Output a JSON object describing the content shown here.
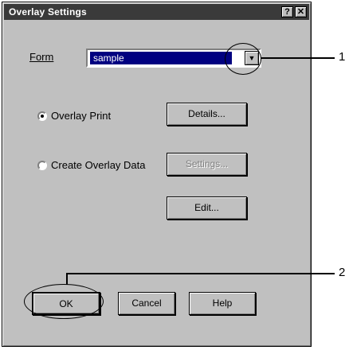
{
  "window": {
    "title": "Overlay Settings",
    "help_glyph": "?",
    "close_glyph": "✕"
  },
  "form": {
    "label": "Form",
    "selected_value": "sample",
    "dropdown_glyph": "▼"
  },
  "overlay_print": {
    "label": "Overlay Print",
    "selected": true,
    "details_button": "Details..."
  },
  "create_overlay": {
    "label": "Create Overlay Data",
    "selected": false,
    "settings_button": "Settings...",
    "edit_button": "Edit..."
  },
  "buttons": {
    "ok": "OK",
    "cancel": "Cancel",
    "help": "Help"
  },
  "callouts": [
    "1",
    "2"
  ]
}
